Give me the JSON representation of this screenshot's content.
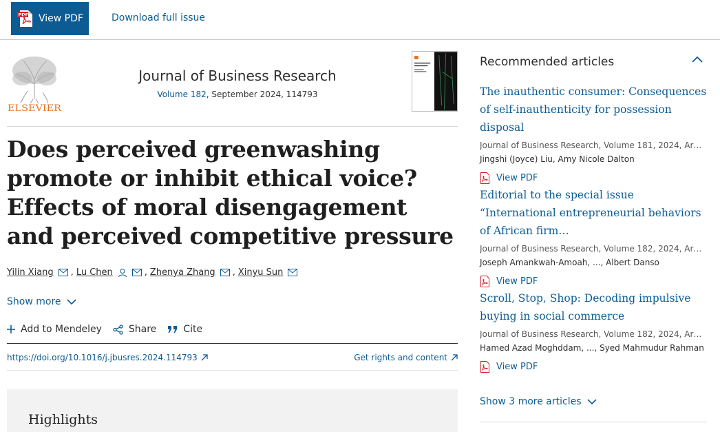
{
  "toolbar": {
    "view_pdf": "View PDF",
    "download_issue": "Download full issue"
  },
  "journal": {
    "publisher": "ELSEVIER",
    "title": "Journal of Business Research",
    "volume": "Volume 182",
    "details": ", September 2024, 114793"
  },
  "article": {
    "title": "Does perceived greenwashing promote or inhibit ethical voice? Effects of moral disengagement and perceived competitive pressure",
    "authors": [
      "Yilin Xiang",
      "Lu Chen",
      "Zhenya Zhang",
      "Xinyu Sun"
    ],
    "show_more": "Show more",
    "actions": {
      "mendeley": "Add to Mendeley",
      "share": "Share",
      "cite": "Cite"
    },
    "doi": "https://doi.org/10.1016/j.jbusres.2024.114793",
    "rights": "Get rights and content",
    "highlights": "Highlights"
  },
  "sidebar": {
    "heading": "Recommended articles",
    "items": [
      {
        "title": "The inauthentic consumer: Consequences of self-inauthenticity for possession disposal",
        "source": "Journal of Business Research, Volume 181, 2024, Articl…",
        "authors": "Jingshi (Joyce) Liu, Amy Nicole Dalton",
        "pdf": "View PDF"
      },
      {
        "title": "Editorial to the special issue “International entrepreneurial behaviors of African firm…",
        "source": "Journal of Business Research, Volume 182, 2024, Articl…",
        "authors": "Joseph Amankwah-Amoah, ..., Albert Danso",
        "pdf": "View PDF"
      },
      {
        "title": "Scroll, Stop, Shop: Decoding impulsive buying in social commerce",
        "source": "Journal of Business Research, Volume 182, 2024, Articl…",
        "authors": "Hamed Azad Moghddam, ..., Syed Mahmudur Rahman",
        "pdf": "View PDF"
      }
    ],
    "show_more": "Show 3 more articles"
  }
}
